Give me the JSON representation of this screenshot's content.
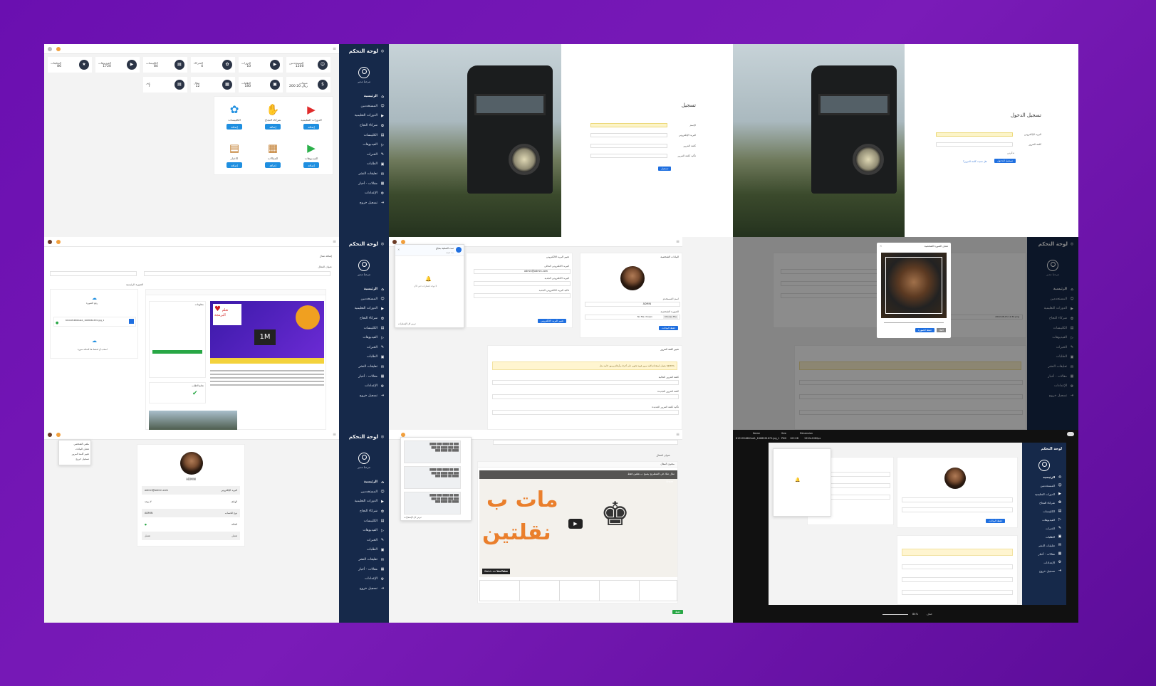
{
  "sidebar": {
    "title": "لوحة التحكم",
    "user": "مرحبا مدير",
    "items": [
      {
        "label": "الرئيسية",
        "icon": "home-icon",
        "glyph": "⌂"
      },
      {
        "label": "المستخدمين",
        "icon": "users-icon",
        "glyph": "☺"
      },
      {
        "label": "الدورات التعليمية",
        "icon": "video-icon",
        "glyph": "▶"
      },
      {
        "label": "شركاء النجاح",
        "icon": "handshake-icon",
        "glyph": "✿"
      },
      {
        "label": "الكليبسات",
        "icon": "clips-icon",
        "glyph": "▤"
      },
      {
        "label": "الفيديوهات",
        "icon": "play-icon",
        "glyph": "▷"
      },
      {
        "label": "الخبرات",
        "icon": "tools-icon",
        "glyph": "✎"
      },
      {
        "label": "الطلبات",
        "icon": "orders-icon",
        "glyph": "▣"
      },
      {
        "label": "تعليقات النشر",
        "icon": "comments-icon",
        "glyph": "✉"
      },
      {
        "label": "مقالات - أخبار",
        "icon": "articles-icon",
        "glyph": "▦"
      },
      {
        "label": "الإعدادات",
        "icon": "settings-icon",
        "glyph": "⚙"
      },
      {
        "label": "تسجيل خروج",
        "icon": "logout-icon",
        "glyph": "⇥"
      }
    ]
  },
  "dashboard": {
    "stats_row1": [
      {
        "label": "المستخدمين",
        "value": "1200",
        "icon": "users-icon",
        "glyph": "☺"
      },
      {
        "label": "الدورات",
        "value": "10",
        "icon": "video-icon",
        "glyph": "▶"
      },
      {
        "label": "الشركاء",
        "value": "4",
        "icon": "handshake-icon",
        "glyph": "✿"
      },
      {
        "label": "الكليبسات",
        "value": "84",
        "icon": "clips-icon",
        "glyph": "▤"
      },
      {
        "label": "الفيديوهات",
        "value": "1720",
        "icon": "play-icon",
        "glyph": "▶"
      },
      {
        "label": "التعليقات",
        "value": "86",
        "icon": "star-icon",
        "glyph": "★"
      }
    ],
    "stats_row2": [
      {
        "label": "مبيعات",
        "value": "200 20 ريال",
        "icon": "money-icon",
        "glyph": "$"
      },
      {
        "label": "الطلبات",
        "value": "180",
        "icon": "orders-icon",
        "glyph": "▣"
      },
      {
        "label": "مقال",
        "value": "12",
        "icon": "articles-icon",
        "glyph": "▦"
      },
      {
        "label": "خبر",
        "value": "7",
        "icon": "news-icon",
        "glyph": "▤"
      }
    ],
    "tiles": [
      {
        "label": "الدورات التعليمية",
        "button": "إضافة",
        "icon": "youtube-icon",
        "glyph": "▶",
        "color": "#e02b2b"
      },
      {
        "label": "شركاء النجاح",
        "button": "إضافة",
        "icon": "handshake-icon",
        "glyph": "✋",
        "color": "#2b3446"
      },
      {
        "label": "الكليبسات",
        "button": "إضافة",
        "icon": "clips-icon",
        "glyph": "✿",
        "color": "#1f8fe0"
      },
      {
        "label": "الفيديوهات",
        "button": "إضافة",
        "icon": "play-icon",
        "glyph": "▶",
        "color": "#2bb04a"
      },
      {
        "label": "المقالات",
        "button": "إضافة",
        "icon": "articles-icon",
        "glyph": "▦",
        "color": "#c07a2a"
      },
      {
        "label": "الاخبار",
        "button": "إضافة",
        "icon": "news-icon",
        "glyph": "▤",
        "color": "#c07a2a"
      }
    ]
  },
  "register": {
    "title": "تسجيل",
    "fields": [
      "الإسم",
      "البريد الإلكتروني",
      "كلمة المرور",
      "تأكيد كلمة المرور"
    ],
    "button": "تسجيل"
  },
  "login": {
    "title": "تسجيل الدخول",
    "fields": [
      "البريد الإلكتروني",
      "كلمة المرور"
    ],
    "remember": "تذكرني",
    "button": "تسجيل الدخول",
    "forgot": "هل نسيت كلمة المرور؟"
  },
  "article_editor": {
    "section": "إضافة مقال",
    "title_label": "عنوان المقال",
    "image_label": "الصورة الرئيسية",
    "upload_label": "رفع الصورة",
    "file_name": "6191054860ab1_1668061670.jpg_1",
    "upload_hint": "اسحب أو اضغط هنا لاضافة صورة",
    "promo_title": "تعلم البرمجة",
    "promo_big": "1M",
    "info_title": "معلومات",
    "success_title": "نجاح الطلب"
  },
  "settings": {
    "email_section": "تغيير البريد الالكتروني",
    "current_email_label": "البريد الالكتروني الحالي",
    "current_email": "admin@admin.com",
    "new_email_label": "البريد الالكتروني الجديد",
    "confirm_email_label": "تاكيد البريد الالكتروني الجديد",
    "email_button": "تغيير البريد الالكتروني",
    "profile_section": "البيانات الشخصية",
    "username_label": "اسم المستخدم",
    "username": "ADMIN",
    "photo_label": "الصورة الشخصية",
    "file_button": "Choose File",
    "file_status": "No file chosen",
    "save_button": "حفظ البيانات",
    "password_section": "تغيير كلمة المرور",
    "warning": "يفضل استخدام كلمة مرور قوية تحتوي على أحرف وأرقام ورموز خاصة مثل !@#$%",
    "old_password_label": "كلمة المرور الحالية",
    "new_password_label": "كلمة المرور الجديدة",
    "confirm_password_label": "تأكيد كلمة المرور الجديدة",
    "notif_title": "تمت العملية بنجاح",
    "notif_sub": "منذ دقيقة",
    "notif_empty": "لا توجد اشعارات حتى الآن",
    "notif_footer": "عرض كل الإشعارات",
    "crop_title": "تعديل الصورة الشخصية",
    "crop_save": "حفظ الصورة",
    "crop_cancel": "الغاء",
    "file_selected": "2022-08-15 12:32.png"
  },
  "profile": {
    "menu": [
      "ملفي الشخصي",
      "تعديل البيانات",
      "تغيير كلمة المرور",
      "تسجيل خروج"
    ],
    "name": "ADMIN",
    "rows": [
      {
        "label": "البريد الإلكتروني",
        "value": "admin@admin.com"
      },
      {
        "label": "الهاتف",
        "value": "لا يوجد"
      },
      {
        "label": "نوع الحساب",
        "value": "ADMIN"
      },
      {
        "label": "الحالة",
        "value": "●"
      },
      {
        "label": "تعديل",
        "value": "تعديل"
      }
    ]
  },
  "video_editor": {
    "title_label": "عنوان المقال",
    "content_label": "محتوى المقال",
    "video_title": "مثال ملك في الشطرنج يصبح ب نقلتين فقط",
    "watch_on": "Watch on",
    "youtube": "YouTube",
    "share": "Share",
    "big_text_1": "مات ب",
    "big_text_2": "نقلتين",
    "submit": "حفظ",
    "notif_footer": "عرض كل الإشعارات"
  },
  "viewer": {
    "headers": [
      "Name",
      "Size",
      "Dimension",
      "Type"
    ],
    "file": "6191054860ab1_1668061670.jpg_1",
    "type": "PNG",
    "size": "100 KB",
    "dimension": "1920x1080px",
    "zoom": "84%",
    "delete": "حذف"
  }
}
